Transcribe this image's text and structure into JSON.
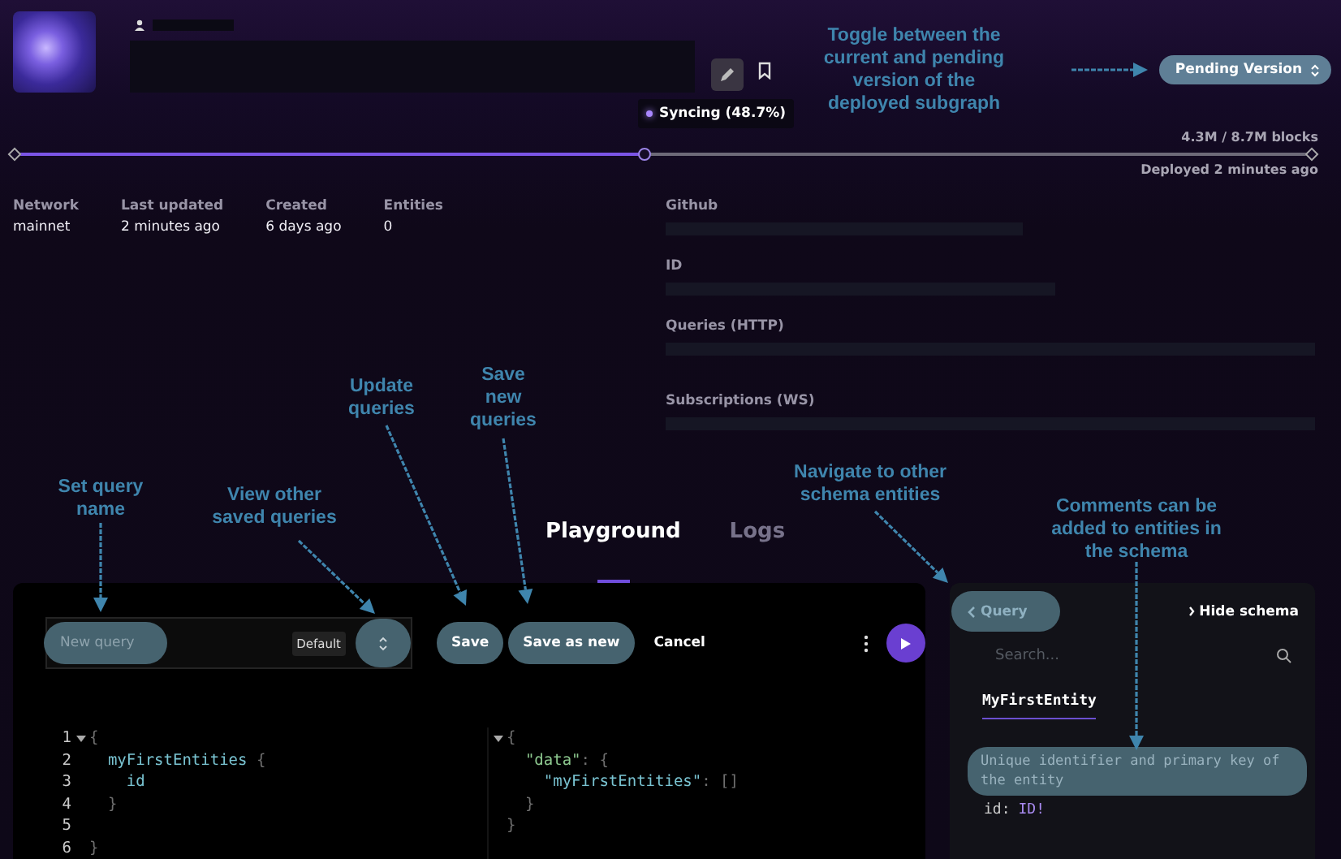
{
  "header": {
    "version_button": "Pending Version"
  },
  "sync": {
    "status": "Syncing (48.7%)",
    "level": 0.485,
    "blocks": "4.3M / 8.7M blocks",
    "deployed": "Deployed 2 minutes ago"
  },
  "stats": [
    {
      "label": "Network",
      "value": "mainnet"
    },
    {
      "label": "Last updated",
      "value": "2 minutes ago"
    },
    {
      "label": "Created",
      "value": "6 days ago"
    },
    {
      "label": "Entities",
      "value": "0"
    }
  ],
  "endpoints": [
    {
      "label": "Github"
    },
    {
      "label": "ID"
    },
    {
      "label": "Queries (HTTP)"
    },
    {
      "label": "Subscriptions (WS)"
    }
  ],
  "tabs": [
    {
      "label": "Playground",
      "selected": true
    },
    {
      "label": "Logs",
      "selected": false
    }
  ],
  "editor": {
    "query_name": {
      "placeholder": "New query"
    },
    "default_badge": "Default",
    "buttons": [
      {
        "label": "Save",
        "kind": "filled"
      },
      {
        "label": "Save as new",
        "kind": "filled"
      },
      {
        "label": "Cancel",
        "kind": "plain"
      }
    ],
    "query_lines": [
      {
        "number": "1",
        "foldable": true,
        "tokens": [
          {
            "text": "{",
            "kind": "punct"
          }
        ]
      },
      {
        "number": "2",
        "foldable": false,
        "tokens": [
          {
            "text": "  myFirstEntities",
            "kind": "field"
          },
          {
            "text": " {",
            "kind": "punct"
          }
        ]
      },
      {
        "number": "3",
        "foldable": false,
        "tokens": [
          {
            "text": "    id",
            "kind": "field"
          }
        ]
      },
      {
        "number": "4",
        "foldable": false,
        "tokens": [
          {
            "text": "  }",
            "kind": "punct"
          }
        ]
      },
      {
        "number": "5",
        "foldable": false
      },
      {
        "number": "6",
        "foldable": false,
        "tokens": [
          {
            "text": "}",
            "kind": "punct"
          }
        ]
      }
    ],
    "result_lines": [
      {
        "foldable": true,
        "tokens": [
          {
            "text": "{",
            "kind": "punct"
          }
        ]
      },
      {
        "foldable": false,
        "tokens": [
          {
            "text": "  \"data\"",
            "kind": "key"
          },
          {
            "text": ": {",
            "kind": "punct"
          }
        ]
      },
      {
        "foldable": false,
        "tokens": [
          {
            "text": "    \"myFirstEntities\"",
            "kind": "field"
          },
          {
            "text": ": []",
            "kind": "punct"
          }
        ]
      },
      {
        "foldable": false,
        "tokens": [
          {
            "text": "  }",
            "kind": "punct"
          }
        ]
      },
      {
        "foldable": false,
        "tokens": [
          {
            "text": "}",
            "kind": "punct"
          }
        ]
      }
    ]
  },
  "schema": {
    "back_button": "Query",
    "hide_button": "Hide schema",
    "search": {
      "placeholder": "Search..."
    },
    "entity_tab": "MyFirstEntity",
    "comment": "Unique identifier and primary key of the entity",
    "field": {
      "name": "id:",
      "type": "ID!"
    }
  },
  "annotations": [
    {
      "text": "Toggle between the current and pending version of the deployed subgraph"
    },
    {
      "text": "Set query name"
    },
    {
      "text": "View other saved queries"
    },
    {
      "text": "Update queries"
    },
    {
      "text": "Save new queries"
    },
    {
      "text": "Navigate to other schema entities"
    },
    {
      "text": "Comments can be added to entities in the schema"
    }
  ]
}
